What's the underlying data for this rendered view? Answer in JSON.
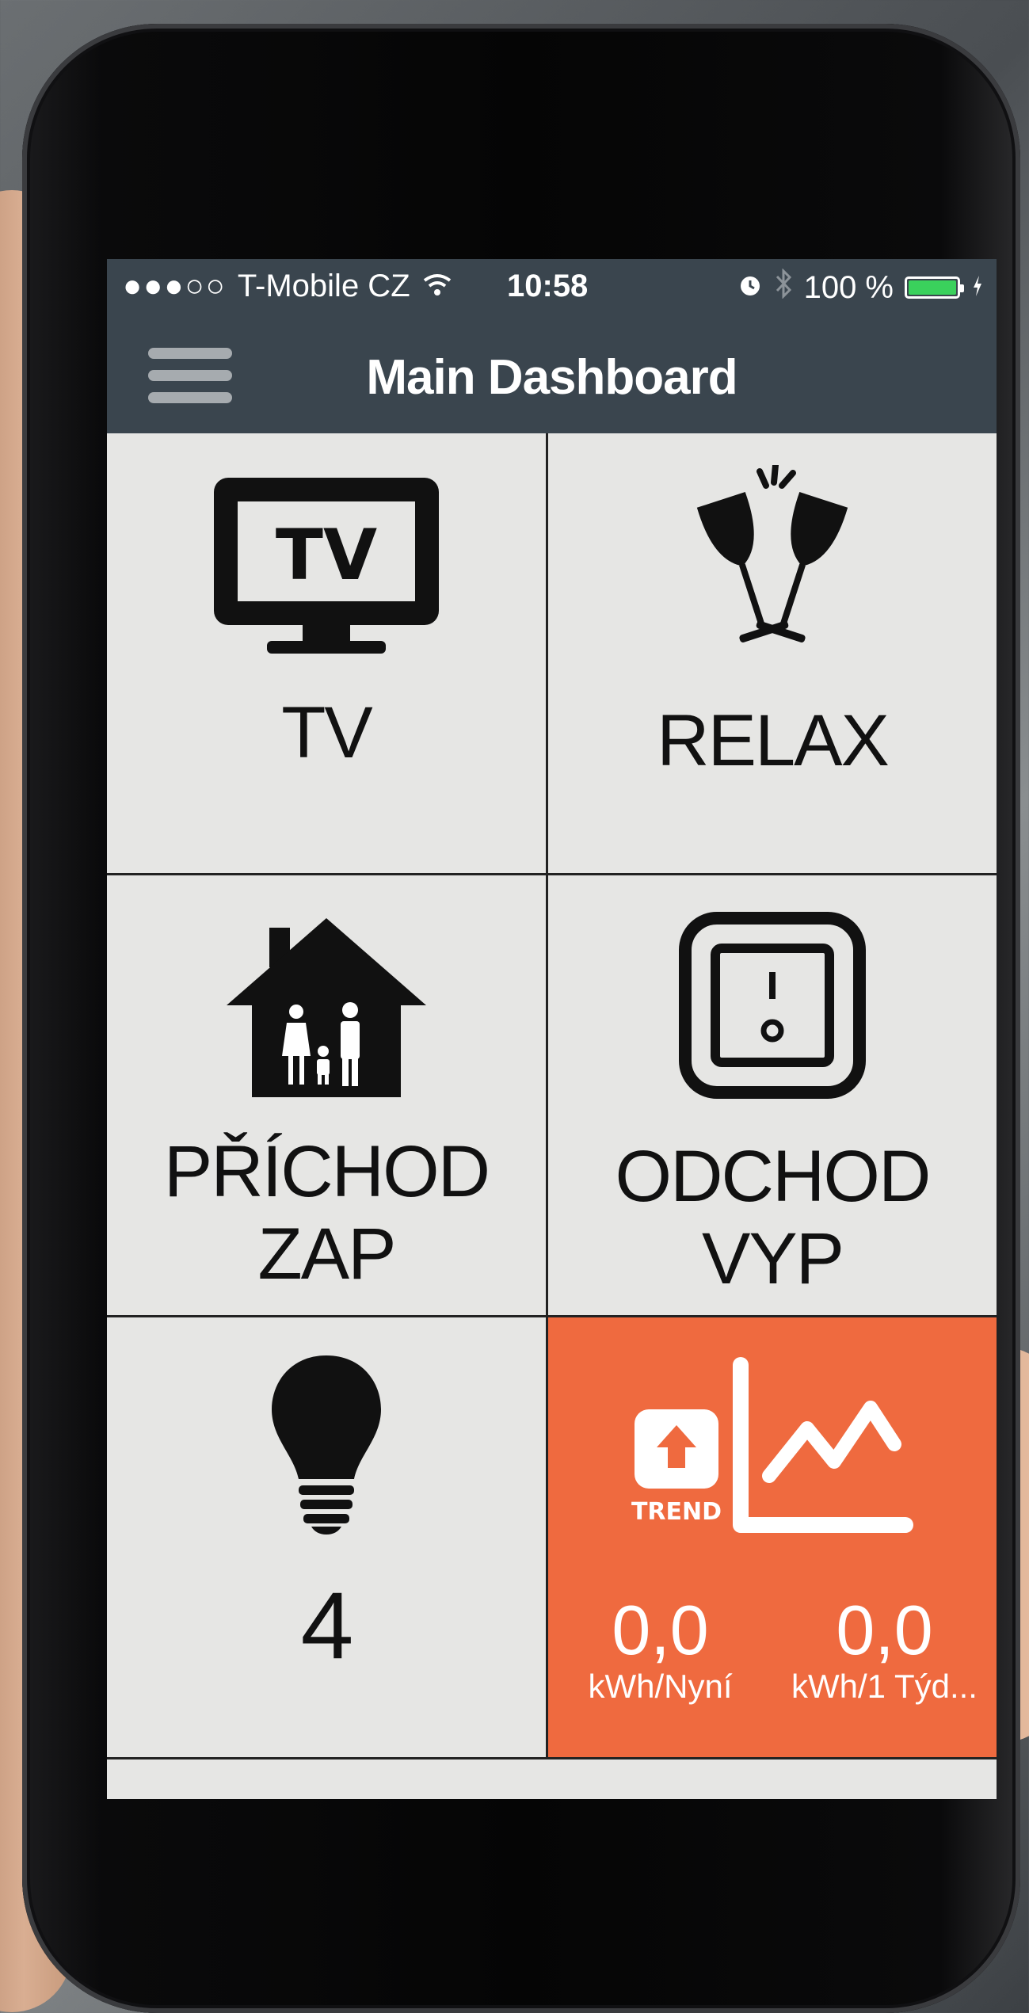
{
  "status_bar": {
    "signal": "●●●○○",
    "carrier": "T-Mobile CZ",
    "time": "10:58",
    "battery": "100 %",
    "battery_color": "#3ad15c"
  },
  "header": {
    "title": "Main Dashboard"
  },
  "tiles": [
    {
      "label": "TV",
      "icon": "tv-icon",
      "icon_text": "TV"
    },
    {
      "label": "RELAX",
      "icon": "wine-glasses-icon"
    },
    {
      "label_line1": "PŘÍCHOD",
      "label_line2": "ZAP",
      "icon": "family-house-icon"
    },
    {
      "label_line1": "ODCHOD",
      "label_line2": "VYP",
      "icon": "switch-icon"
    },
    {
      "label": "4",
      "icon": "light-bulb-icon"
    },
    {
      "icon": "trend-chart-icon",
      "badge": "TREND",
      "values": [
        {
          "value": "0,0",
          "unit": "kWh/Nyní"
        },
        {
          "value": "0,0",
          "unit": "kWh/1 Týd..."
        }
      ],
      "background": "#ef6a3f"
    }
  ],
  "colors": {
    "header_bg": "#3a454e",
    "tile_bg": "#e6e6e4",
    "accent": "#ef6a3f"
  }
}
